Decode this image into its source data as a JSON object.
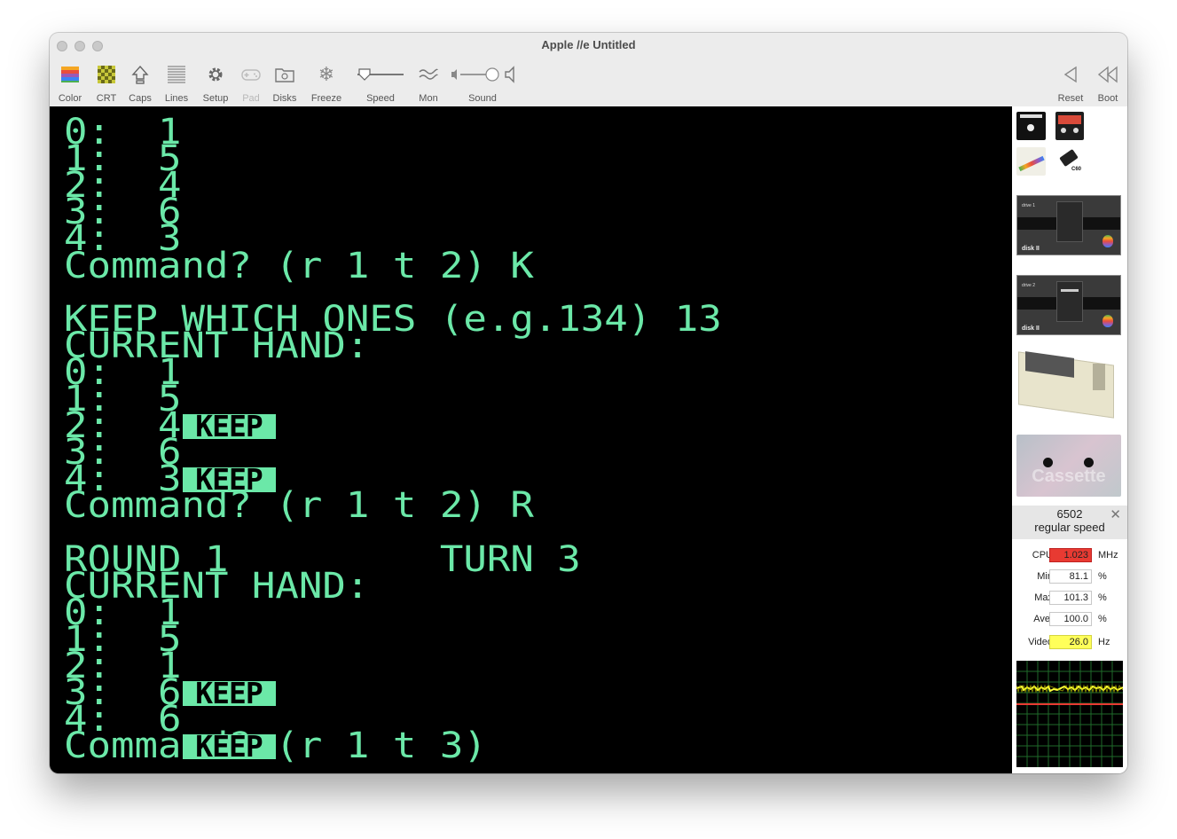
{
  "window": {
    "title": "Apple //e   Untitled"
  },
  "toolbar": {
    "color": "Color",
    "crt": "CRT",
    "caps": "Caps",
    "lines": "Lines",
    "setup": "Setup",
    "pad": "Pad",
    "disks": "Disks",
    "freeze": "Freeze",
    "speed": "Speed",
    "mon": "Mon",
    "sound": "Sound",
    "reset": "Reset",
    "boot": "Boot"
  },
  "screen": {
    "lines": [
      "0:  1",
      "1:  5",
      "2:  4",
      "3:  6",
      "4:  3",
      "Command? (r 1 t 2) K",
      "",
      "KEEP WHICH ONES (e.g.134) 13",
      "CURRENT HAND:",
      "0:  1",
      "1:  5",
      "2:  4",
      "3:  6",
      "4:  3",
      "Command? (r 1 t 2) R",
      "",
      "ROUND 1         TURN 3",
      "CURRENT HAND:",
      "0:  1",
      "1:  5",
      "2:  1",
      "3:  6",
      "4:  6",
      "Command? (r 1 t 3)"
    ],
    "keep_label": "KEEP"
  },
  "sidebar": {
    "cassette_label": "Cassette",
    "tape_label": "C60",
    "drive1_label": "drive 1",
    "drive2_label": "drive 2",
    "disk_brand": "disk II"
  },
  "cpu_panel": {
    "title": "6502",
    "subtitle": "regular speed",
    "cpu_label": "CPU",
    "cpu_value": "1.023",
    "cpu_unit": "MHz",
    "min_label": "Min",
    "min_value": "81.1",
    "min_unit": "%",
    "max_label": "Max",
    "max_value": "101.3",
    "max_unit": "%",
    "ave_label": "Ave.",
    "ave_value": "100.0",
    "ave_unit": "%",
    "video_label": "Video",
    "video_value": "26.0",
    "video_unit": "Hz"
  },
  "colors": {
    "phosphor": "#6be8a8",
    "cpu_highlight": "#e83a32",
    "video_highlight": "#ffff5a"
  }
}
